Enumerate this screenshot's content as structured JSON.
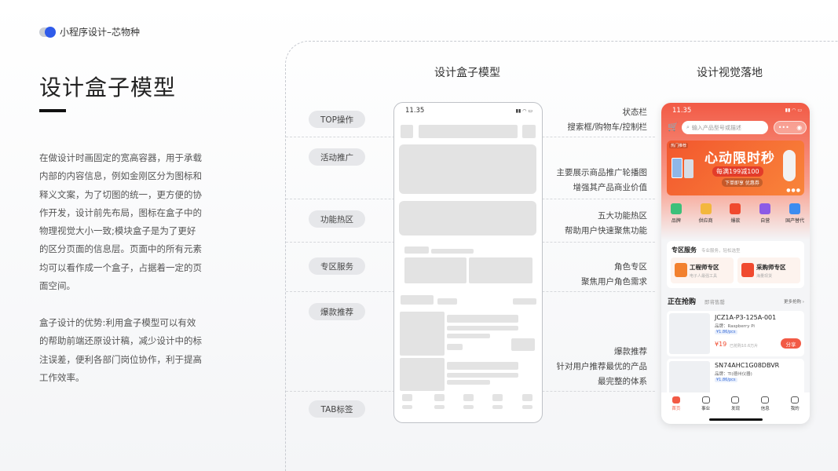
{
  "brand": {
    "text": "小程序设计–芯物种"
  },
  "title": "设计盒子模型",
  "paragraphs": [
    "在做设计时画固定的宽高容器，用于承载内部的内容信息，例如金刚区分为图标和释义文案，为了切图的统一，更方便的协作开发，设计前先布局，图标在盒子中的物理视觉大小一致;模块盒子是为了更好的区分页面的信息层。页面中的所有元素均可以看作成一个盒子，占据着一定的页面空间。",
    "盒子设计的优势:利用盒子模型可以有效的帮助前端还原设计稿，减少设计中的标注误差，便利各部门岗位协作，利于提高工作效率。"
  ],
  "columns": {
    "wireframe_title": "设计盒子模型",
    "visual_title": "设计视觉落地"
  },
  "pills": [
    "TOP操作",
    "活动推广",
    "功能热区",
    "专区服务",
    "爆款推荐",
    "TAB标签"
  ],
  "descriptions": {
    "status_bar": "状态栏",
    "search_row": "搜索框/购物车/控制栏",
    "banner_1": "主要展示商品推广轮播图",
    "banner_2": "增强其产品商业价值",
    "hot_1": "五大功能热区",
    "hot_2": "帮助用户快速聚焦功能",
    "zone_1": "角色专区",
    "zone_2": "聚焦用户角色需求",
    "rec_1": "爆款推荐",
    "rec_2": "针对用户推荐最优的产品",
    "rec_3": "最完整的体系"
  },
  "wireframe": {
    "time": "11.35"
  },
  "phone": {
    "time": "11.35",
    "search_placeholder": "输入产品型号或描述",
    "banner": {
      "tag": "热门推荐",
      "title": "心动限时秒",
      "subtitle": "每满199减100",
      "button": "下单即享 优惠券"
    },
    "categories": [
      {
        "label": "品牌",
        "color": "#3cc07a"
      },
      {
        "label": "供应商",
        "color": "#f3b73d"
      },
      {
        "label": "爆款",
        "color": "#f04a2f"
      },
      {
        "label": "自营",
        "color": "#8c5be6"
      },
      {
        "label": "国产替代",
        "color": "#3c8cf0"
      }
    ],
    "zone": {
      "title": "专区服务",
      "subtitle": "专业服务，轻松选型",
      "cards": [
        {
          "title": "工程师专区",
          "sub": "电子人最强工具",
          "color": "#f2812f"
        },
        {
          "title": "采购师专区",
          "sub": "海量现货",
          "color": "#f04a2f"
        }
      ]
    },
    "hot": {
      "title": "正在抢购",
      "tab2": "即将售罄",
      "more": "更多抢购 ›"
    },
    "products": [
      {
        "name": "JCZ1A-P3-125A-001",
        "brand": "品牌：Raspberry Pi",
        "tag": "¥1.86/pcs",
        "price": "¥19",
        "sold": "已抢购10.6万片",
        "button": "分享"
      },
      {
        "name": "SN74AHC1G08DBVR",
        "brand": "品牌：TI(德州仪器)",
        "tag": "¥1.86/pcs",
        "price": "¥19",
        "sold": "已抢购10.6万片",
        "button": "分享"
      }
    ],
    "tabs": [
      "首页",
      "事业",
      "发现",
      "信息",
      "我的"
    ]
  }
}
